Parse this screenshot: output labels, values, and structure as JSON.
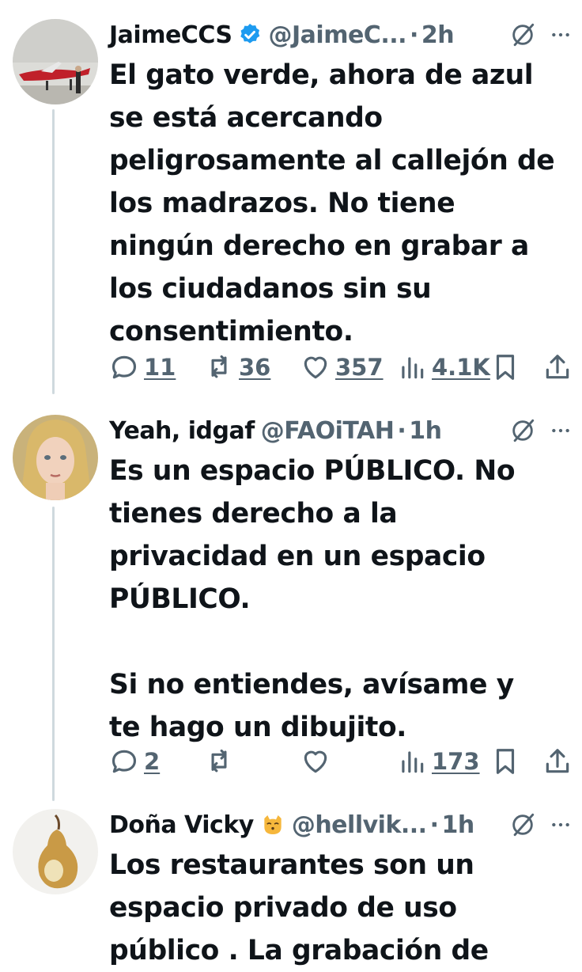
{
  "colors": {
    "text": "#0f1419",
    "secondary": "#536471",
    "verified": "#1d9bf0",
    "thread_line": "#cfd9de"
  },
  "tweets": [
    {
      "name": "JaimeCCS",
      "handle": "@JaimeC...",
      "dot": "·",
      "time": "2h",
      "badge": "verified-badge-icon",
      "body": "El gato verde, ahora de azul se está acercando peligrosamente al callejón de los madrazos. No tiene ningún derecho en grabar a los ciudadanos sin su consentimiento.",
      "replies": "11",
      "reposts": "36",
      "likes": "357",
      "views": "4.1K"
    },
    {
      "name": "Yeah, idgaf",
      "handle": "@FAOiTAH",
      "dot": "·",
      "time": "1h",
      "body": "Es un espacio PÚBLICO. No tienes derecho a la privacidad en un espacio PÚBLICO.\n\nSi no entiendes, avísame y te hago un dibujito.",
      "replies": "2",
      "reposts": "",
      "likes": "",
      "views": "173"
    },
    {
      "name": "Doña Vicky",
      "emoji": "kissing-cat-emoji",
      "handle": "@hellvik...",
      "dot": "·",
      "time": "1h",
      "body": "Los restaurantes son un espacio privado de uso público . La grabación de"
    }
  ]
}
